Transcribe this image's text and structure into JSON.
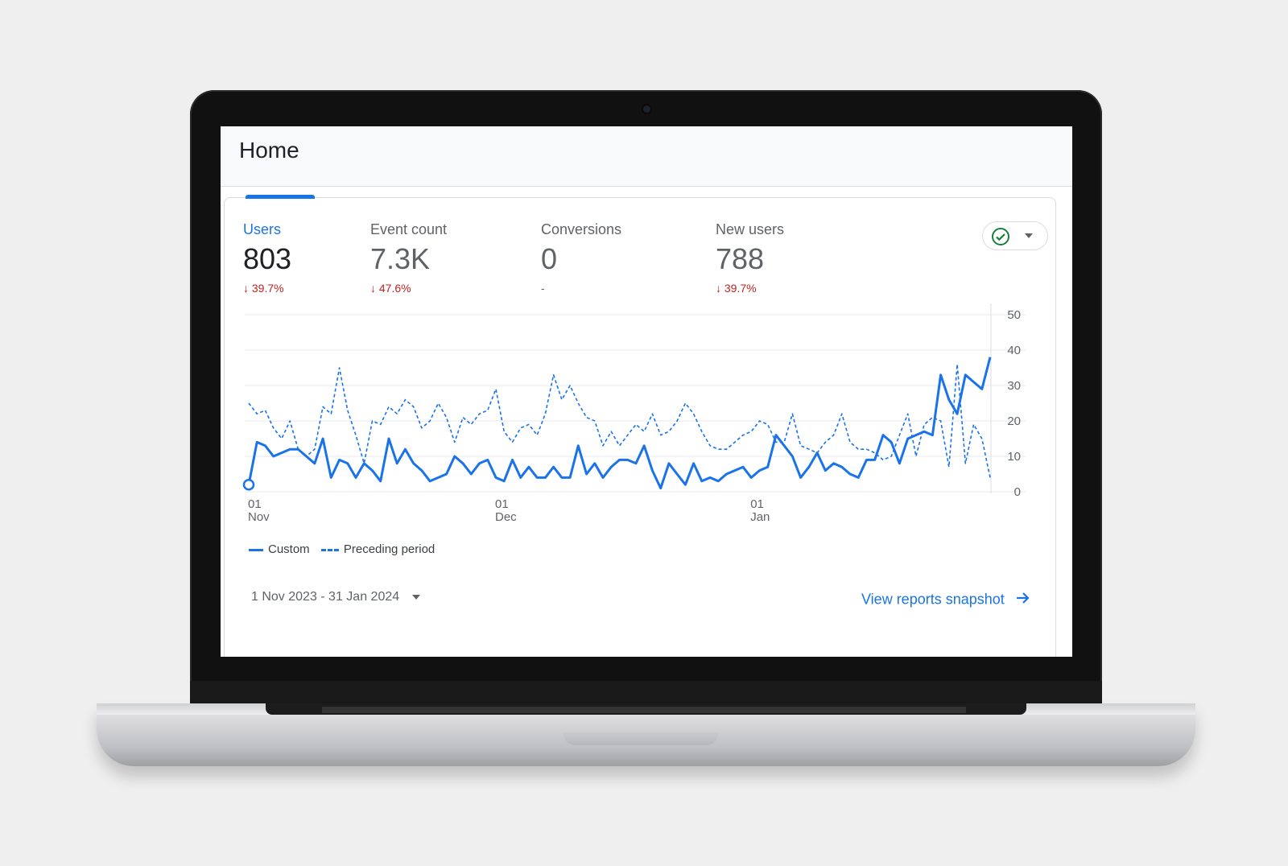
{
  "header": {
    "title": "Home"
  },
  "metrics": [
    {
      "label": "Users",
      "value": "803",
      "delta": "39.7%",
      "trend": "down",
      "active": true
    },
    {
      "label": "Event count",
      "value": "7.3K",
      "delta": "47.6%",
      "trend": "down",
      "active": false
    },
    {
      "label": "Conversions",
      "value": "0",
      "delta": "-",
      "trend": "none",
      "active": false
    },
    {
      "label": "New users",
      "value": "788",
      "delta": "39.7%",
      "trend": "down",
      "active": false
    }
  ],
  "status_button": {
    "icon": "check-circle-icon",
    "color": "#188038"
  },
  "chart_data": {
    "type": "line",
    "ylim": [
      0,
      50
    ],
    "y_ticks": [
      "50",
      "40",
      "30",
      "20",
      "10",
      "0"
    ],
    "x_ticks": [
      {
        "day": "01",
        "month": "Nov",
        "index": 0
      },
      {
        "day": "01",
        "month": "Dec",
        "index": 30
      },
      {
        "day": "01",
        "month": "Jan",
        "index": 61
      }
    ],
    "series": [
      {
        "name": "Custom",
        "style": "solid",
        "values": [
          2,
          14,
          13,
          10,
          11,
          12,
          12,
          10,
          8,
          15,
          4,
          9,
          8,
          4,
          8,
          6,
          3,
          15,
          8,
          12,
          8,
          6,
          3,
          4,
          5,
          10,
          8,
          5,
          8,
          9,
          4,
          3,
          9,
          4,
          7,
          4,
          4,
          7,
          4,
          4,
          13,
          5,
          8,
          4,
          7,
          9,
          9,
          8,
          13,
          6,
          1,
          8,
          5,
          2,
          8,
          3,
          4,
          3,
          5,
          6,
          7,
          4,
          6,
          7,
          16,
          13,
          10,
          4,
          7,
          11,
          6,
          8,
          7,
          5,
          4,
          9,
          9,
          16,
          14,
          8,
          15,
          16,
          17,
          16,
          33,
          26,
          22,
          33,
          31,
          29,
          38
        ]
      },
      {
        "name": "Preceding period",
        "style": "dashed",
        "values": [
          25,
          22,
          23,
          18,
          15,
          20,
          12,
          10,
          12,
          24,
          22,
          35,
          23,
          16,
          8,
          20,
          19,
          24,
          22,
          26,
          24,
          18,
          20,
          25,
          21,
          14,
          21,
          19,
          22,
          23,
          29,
          17,
          14,
          18,
          19,
          16,
          22,
          33,
          26,
          30,
          25,
          21,
          20,
          13,
          17,
          13,
          16,
          19,
          17,
          22,
          16,
          17,
          20,
          25,
          22,
          17,
          13,
          12,
          12,
          14,
          16,
          17,
          20,
          19,
          14,
          14,
          22,
          13,
          12,
          11,
          14,
          16,
          22,
          14,
          12,
          12,
          11,
          9,
          10,
          16,
          22,
          10,
          19,
          21,
          20,
          7,
          36,
          8,
          19,
          15,
          4
        ]
      }
    ]
  },
  "legend": {
    "custom": "Custom",
    "preceding": "Preceding period"
  },
  "footer": {
    "date_range": "1 Nov 2023 - 31 Jan 2024",
    "view_link": "View reports snapshot"
  }
}
